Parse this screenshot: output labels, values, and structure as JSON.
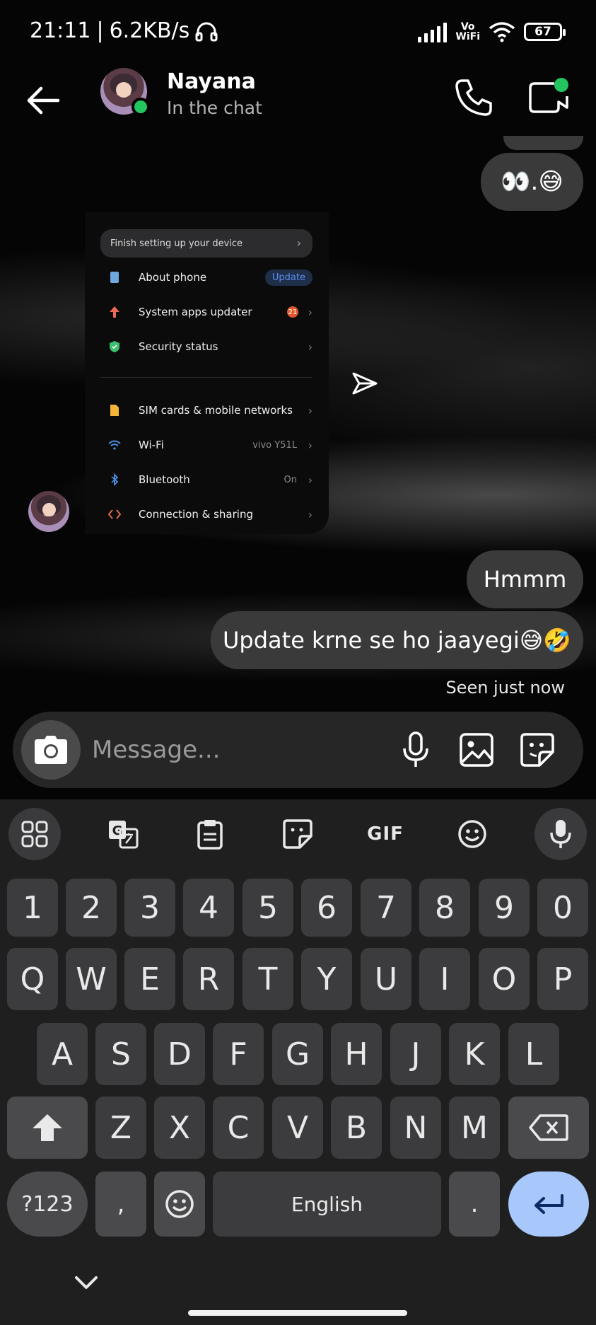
{
  "status_bar": {
    "time": "21:11",
    "separator": "|",
    "speed": "6.2KB/s",
    "vowifi_line1": "Vo",
    "vowifi_line2": "WiFi",
    "battery": "67"
  },
  "header": {
    "contact_name": "Nayana",
    "contact_status": "In the chat"
  },
  "messages": {
    "emoji_message": "👀.😅",
    "hmmm": "Hmmm",
    "update": "Update krne se ho jaayegi😅🤣",
    "seen": "Seen just now"
  },
  "attachment": {
    "banner": "Finish setting up your device",
    "rows": [
      {
        "label": "About phone",
        "value": "",
        "action": "Update"
      },
      {
        "label": "System apps updater",
        "value": "",
        "badge": "21"
      },
      {
        "label": "Security status",
        "value": ""
      },
      {
        "label": "SIM cards & mobile networks",
        "value": ""
      },
      {
        "label": "Wi-Fi",
        "value": "vivo Y51L"
      },
      {
        "label": "Bluetooth",
        "value": "On"
      },
      {
        "label": "Connection & sharing",
        "value": ""
      }
    ]
  },
  "composer": {
    "placeholder": "Message..."
  },
  "keyboard": {
    "gif_label": "GIF",
    "numbers": [
      "1",
      "2",
      "3",
      "4",
      "5",
      "6",
      "7",
      "8",
      "9",
      "0"
    ],
    "row1": [
      "Q",
      "W",
      "E",
      "R",
      "T",
      "Y",
      "U",
      "I",
      "O",
      "P"
    ],
    "row2": [
      "A",
      "S",
      "D",
      "F",
      "G",
      "H",
      "J",
      "K",
      "L"
    ],
    "row3": [
      "Z",
      "X",
      "C",
      "V",
      "B",
      "N",
      "M"
    ],
    "sym_label": "?123",
    "comma": ",",
    "space_label": "English",
    "period": "."
  },
  "colors": {
    "bubble": "#3a3a3a",
    "online": "#22c55e",
    "enter_key": "#a8c7fa"
  }
}
